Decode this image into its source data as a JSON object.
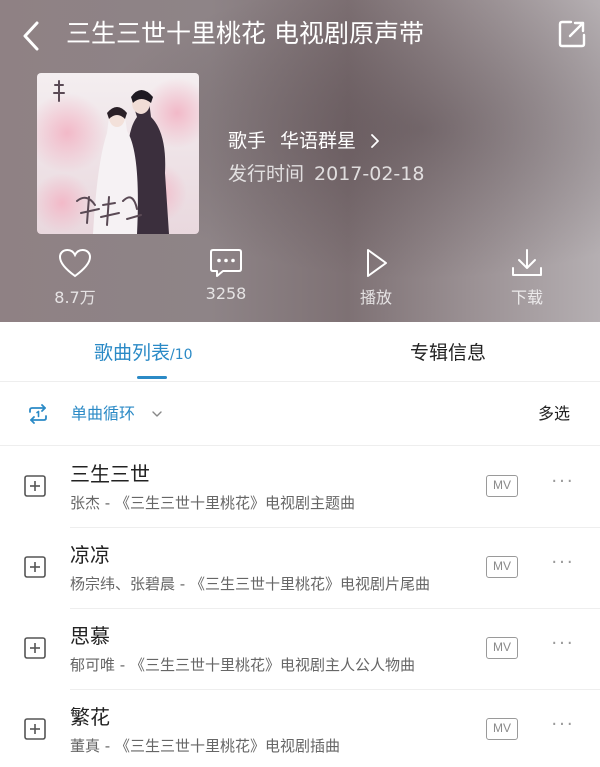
{
  "header": {
    "title": "三生三世十里桃花 电视剧原声带",
    "artist_label": "歌手",
    "artist_name": "华语群星",
    "release_label": "发行时间",
    "release_date": "2017-02-18"
  },
  "actions": {
    "like_count": "8.7万",
    "comment_count": "3258",
    "play_label": "播放",
    "download_label": "下载"
  },
  "tabs": {
    "songs_label": "歌曲列表",
    "songs_count": "/10",
    "album_info_label": "专辑信息"
  },
  "toolbar": {
    "mode_label": "单曲循环",
    "multi_select_label": "多选"
  },
  "songs": [
    {
      "name": "三生三世",
      "subtitle": "张杰 - 《三生三世十里桃花》电视剧主题曲",
      "mv": "MV",
      "more": "···"
    },
    {
      "name": "凉凉",
      "subtitle": "杨宗纬、张碧晨 - 《三生三世十里桃花》电视剧片尾曲",
      "mv": "MV",
      "more": "···"
    },
    {
      "name": "思慕",
      "subtitle": "郁可唯 - 《三生三世十里桃花》电视剧主人公人物曲",
      "mv": "MV",
      "more": "···"
    },
    {
      "name": "繁花",
      "subtitle": "董真 - 《三生三世十里桃花》电视剧插曲",
      "mv": "MV",
      "more": "···"
    }
  ],
  "colors": {
    "accent": "#2b8ac6",
    "header_bg": "#8e8487"
  },
  "icons": {
    "back": "chevron-left-icon",
    "share": "share-icon",
    "like": "heart-icon",
    "comment": "comment-icon",
    "play": "play-icon",
    "download": "download-icon",
    "loop": "repeat-one-icon",
    "add": "plus-square-icon",
    "more": "more-dots-icon"
  }
}
